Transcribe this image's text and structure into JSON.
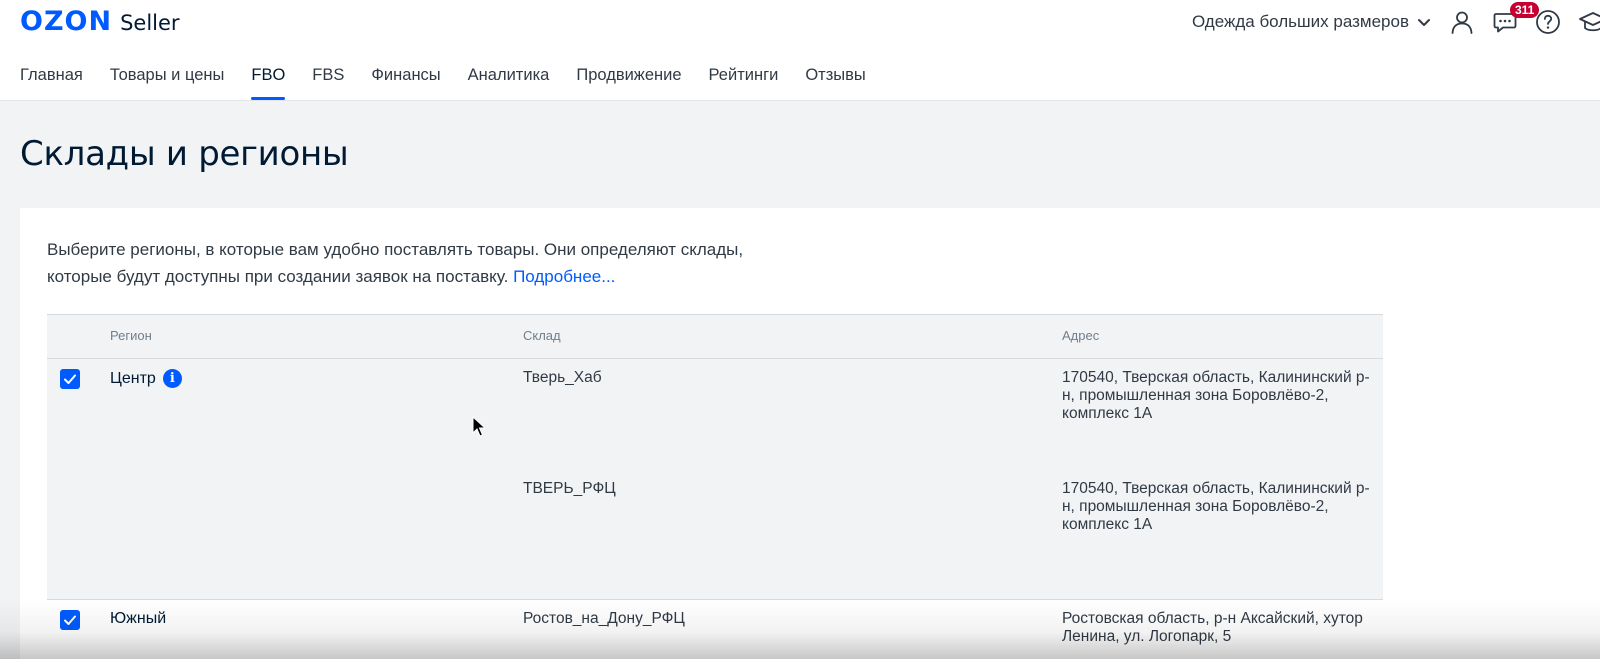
{
  "header": {
    "logo_brand": "OZON",
    "logo_product": "Seller",
    "store_name": "Одежда больших размеров",
    "messages_badge": "311"
  },
  "nav": {
    "items": [
      {
        "label": "Главная",
        "active": false
      },
      {
        "label": "Товары и цены",
        "active": false
      },
      {
        "label": "FBO",
        "active": true
      },
      {
        "label": "FBS",
        "active": false
      },
      {
        "label": "Финансы",
        "active": false
      },
      {
        "label": "Аналитика",
        "active": false
      },
      {
        "label": "Продвижение",
        "active": false
      },
      {
        "label": "Рейтинги",
        "active": false
      },
      {
        "label": "Отзывы",
        "active": false
      }
    ]
  },
  "page": {
    "title": "Склады и регионы",
    "intro_text": "Выберите регионы, в которые вам удобно поставлять товары. Они определяют склады, которые будут доступны при создании заявок на поставку.",
    "intro_link": "Подробнее..."
  },
  "table": {
    "columns": {
      "region": "Регион",
      "warehouse": "Склад",
      "address": "Адрес"
    },
    "groups": [
      {
        "region": "Центр",
        "checked": true,
        "has_info": true,
        "warehouses": [
          {
            "name": "Тверь_Хаб",
            "address": "170540, Тверская область, Калининский р-н, промышленная зона Боровлёво-2, комплекс 1А"
          },
          {
            "name": "ТВЕРЬ_РФЦ",
            "address": "170540, Тверская область, Калининский р-н, промышленная зона Боровлёво-2, комплекс 1А"
          }
        ]
      },
      {
        "region": "Южный",
        "checked": true,
        "has_info": false,
        "warehouses": [
          {
            "name": "Ростов_на_Дону_РФЦ",
            "address": "Ростовская область, р-н Аксайский, хутор Ленина, ул. Логопарк, 5"
          }
        ]
      }
    ]
  },
  "colors": {
    "accent": "#005bff",
    "badge": "#c40032",
    "text": "#001a34",
    "muted": "#707f8d"
  },
  "icons": [
    "chevron-down-icon",
    "user-icon",
    "chat-icon",
    "help-icon",
    "graduation-cap-icon",
    "check-icon",
    "info-icon",
    "mouse-cursor-icon"
  ]
}
